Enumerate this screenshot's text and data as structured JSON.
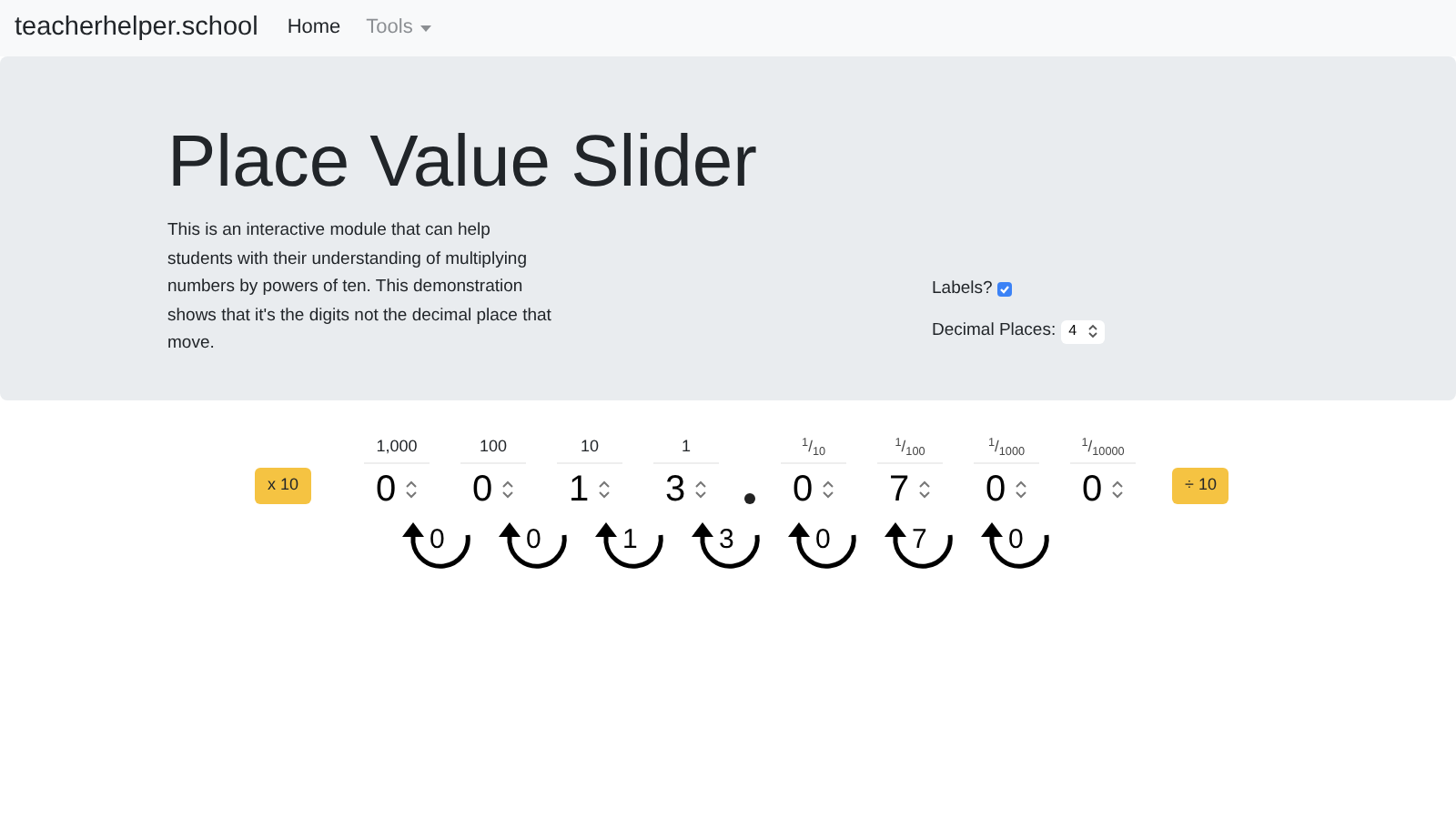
{
  "navbar": {
    "brand": "teacherhelper.school",
    "links": [
      {
        "label": "Home",
        "selected": true,
        "kind": "link"
      },
      {
        "label": "Tools",
        "selected": false,
        "kind": "dropdown"
      }
    ]
  },
  "header": {
    "title": "Place Value Slider",
    "description": "This is an interactive module that can help students with their understanding of multiplying numbers by powers of ten. This demonstration shows that it's the digits not the decimal place that move.",
    "labels_toggle": {
      "label": "Labels?",
      "checked": true
    },
    "decimal_places": {
      "label": "Decimal Places:",
      "value": "4"
    }
  },
  "multiply_button": "x 10",
  "divide_button": "÷ 10",
  "places": [
    {
      "label": "1,000",
      "value": "0",
      "kind": "whole"
    },
    {
      "label": "100",
      "value": "0",
      "kind": "whole"
    },
    {
      "label": "10",
      "value": "1",
      "kind": "whole"
    },
    {
      "label": "1",
      "value": "3",
      "kind": "whole"
    },
    {
      "label": "$^{1}$/$_{10}$",
      "value": "0",
      "kind": "decimal"
    },
    {
      "label": "$^{1}$/$_{100}$",
      "value": "7",
      "kind": "decimal"
    },
    {
      "label": "$^{1}$/$_{1000}$",
      "value": "0",
      "kind": "decimal"
    },
    {
      "label": "$^{1}$/$_{10000}$",
      "value": "0",
      "kind": "decimal"
    }
  ],
  "moving_digits": [
    "0",
    "0",
    "1",
    "3",
    "0",
    "7",
    "0"
  ]
}
